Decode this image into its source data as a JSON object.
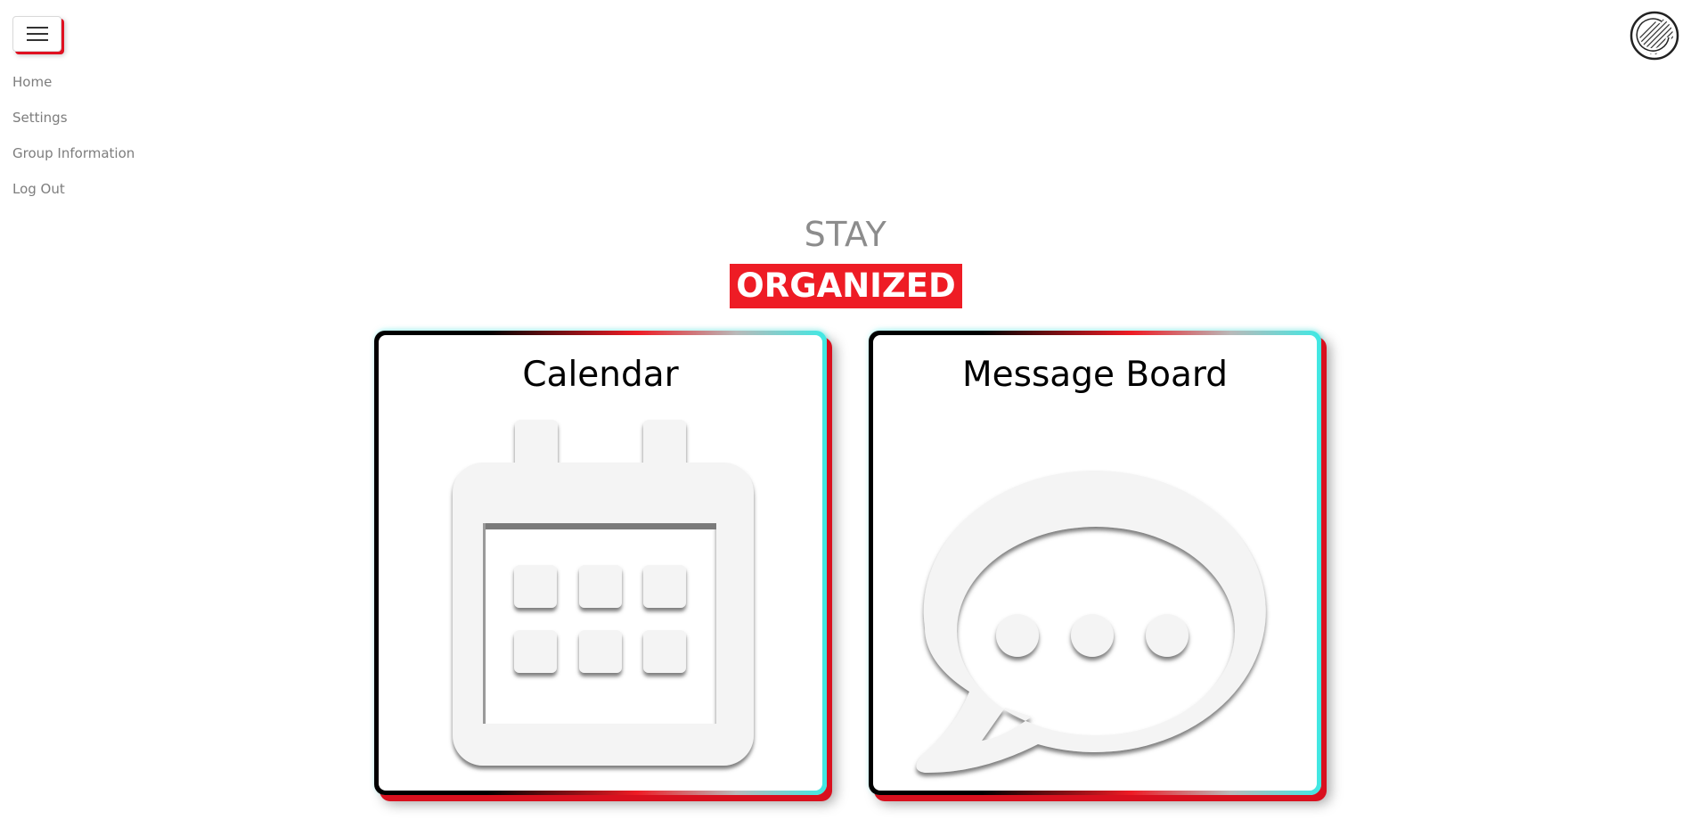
{
  "menu_button": {
    "icon": "hamburger-menu-icon"
  },
  "nav": {
    "items": [
      {
        "label": "Home"
      },
      {
        "label": "Settings"
      },
      {
        "label": "Group Information"
      },
      {
        "label": "Log Out"
      }
    ]
  },
  "logo": {
    "icon": "circle-logo-icon"
  },
  "hero": {
    "top_text": "STAY",
    "badge_text": "ORGANIZED",
    "badge_color": "#ee1c25"
  },
  "cards": [
    {
      "title": "Calendar",
      "icon": "calendar-icon"
    },
    {
      "title": "Message Board",
      "icon": "chat-bubble-icon"
    }
  ],
  "colors": {
    "accent_red": "#ee1c25",
    "accent_cyan": "#3ee9e4",
    "nav_text": "#7d7d7d"
  }
}
